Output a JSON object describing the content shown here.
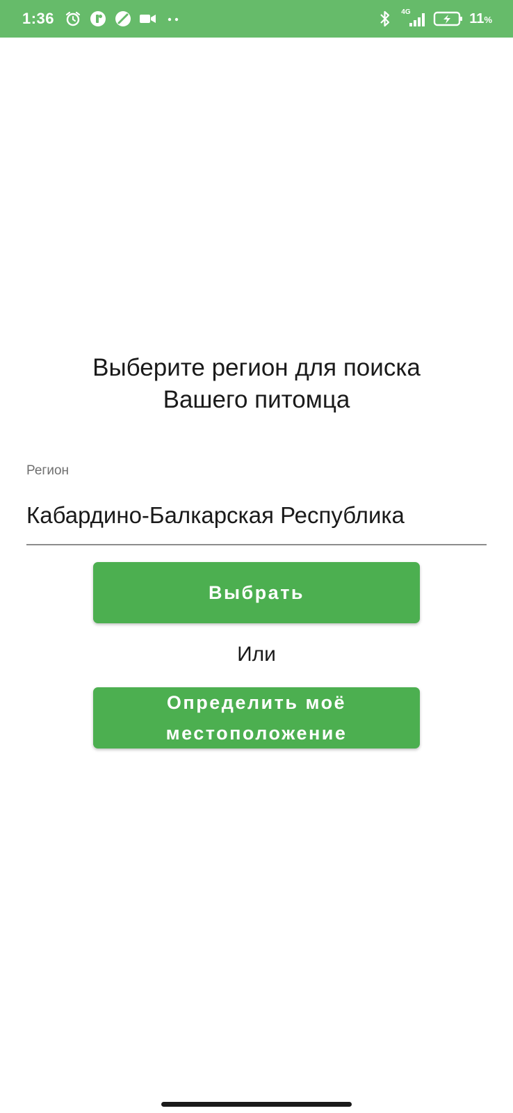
{
  "status_bar": {
    "time": "1:36",
    "network_label": "4G",
    "battery_percent": "11",
    "battery_unit": "%",
    "background_color": "#66bb6a",
    "icons": [
      "alarm-icon",
      "app-notification-icon",
      "no-entry-icon",
      "video-camera-icon",
      "more-dots-icon",
      "bluetooth-icon",
      "signal-icon",
      "battery-charging-icon"
    ]
  },
  "main": {
    "title_line1": "Выберите регион для поиска",
    "title_line2": "Вашего питомца",
    "region_label": "Регион",
    "region_value": "Кабардино-Балкарская Республика",
    "select_button_label": "Выбрать",
    "or_text": "Или",
    "locate_button_line1": "Определить моё",
    "locate_button_line2": "местоположение",
    "accent_color": "#4caf50"
  }
}
